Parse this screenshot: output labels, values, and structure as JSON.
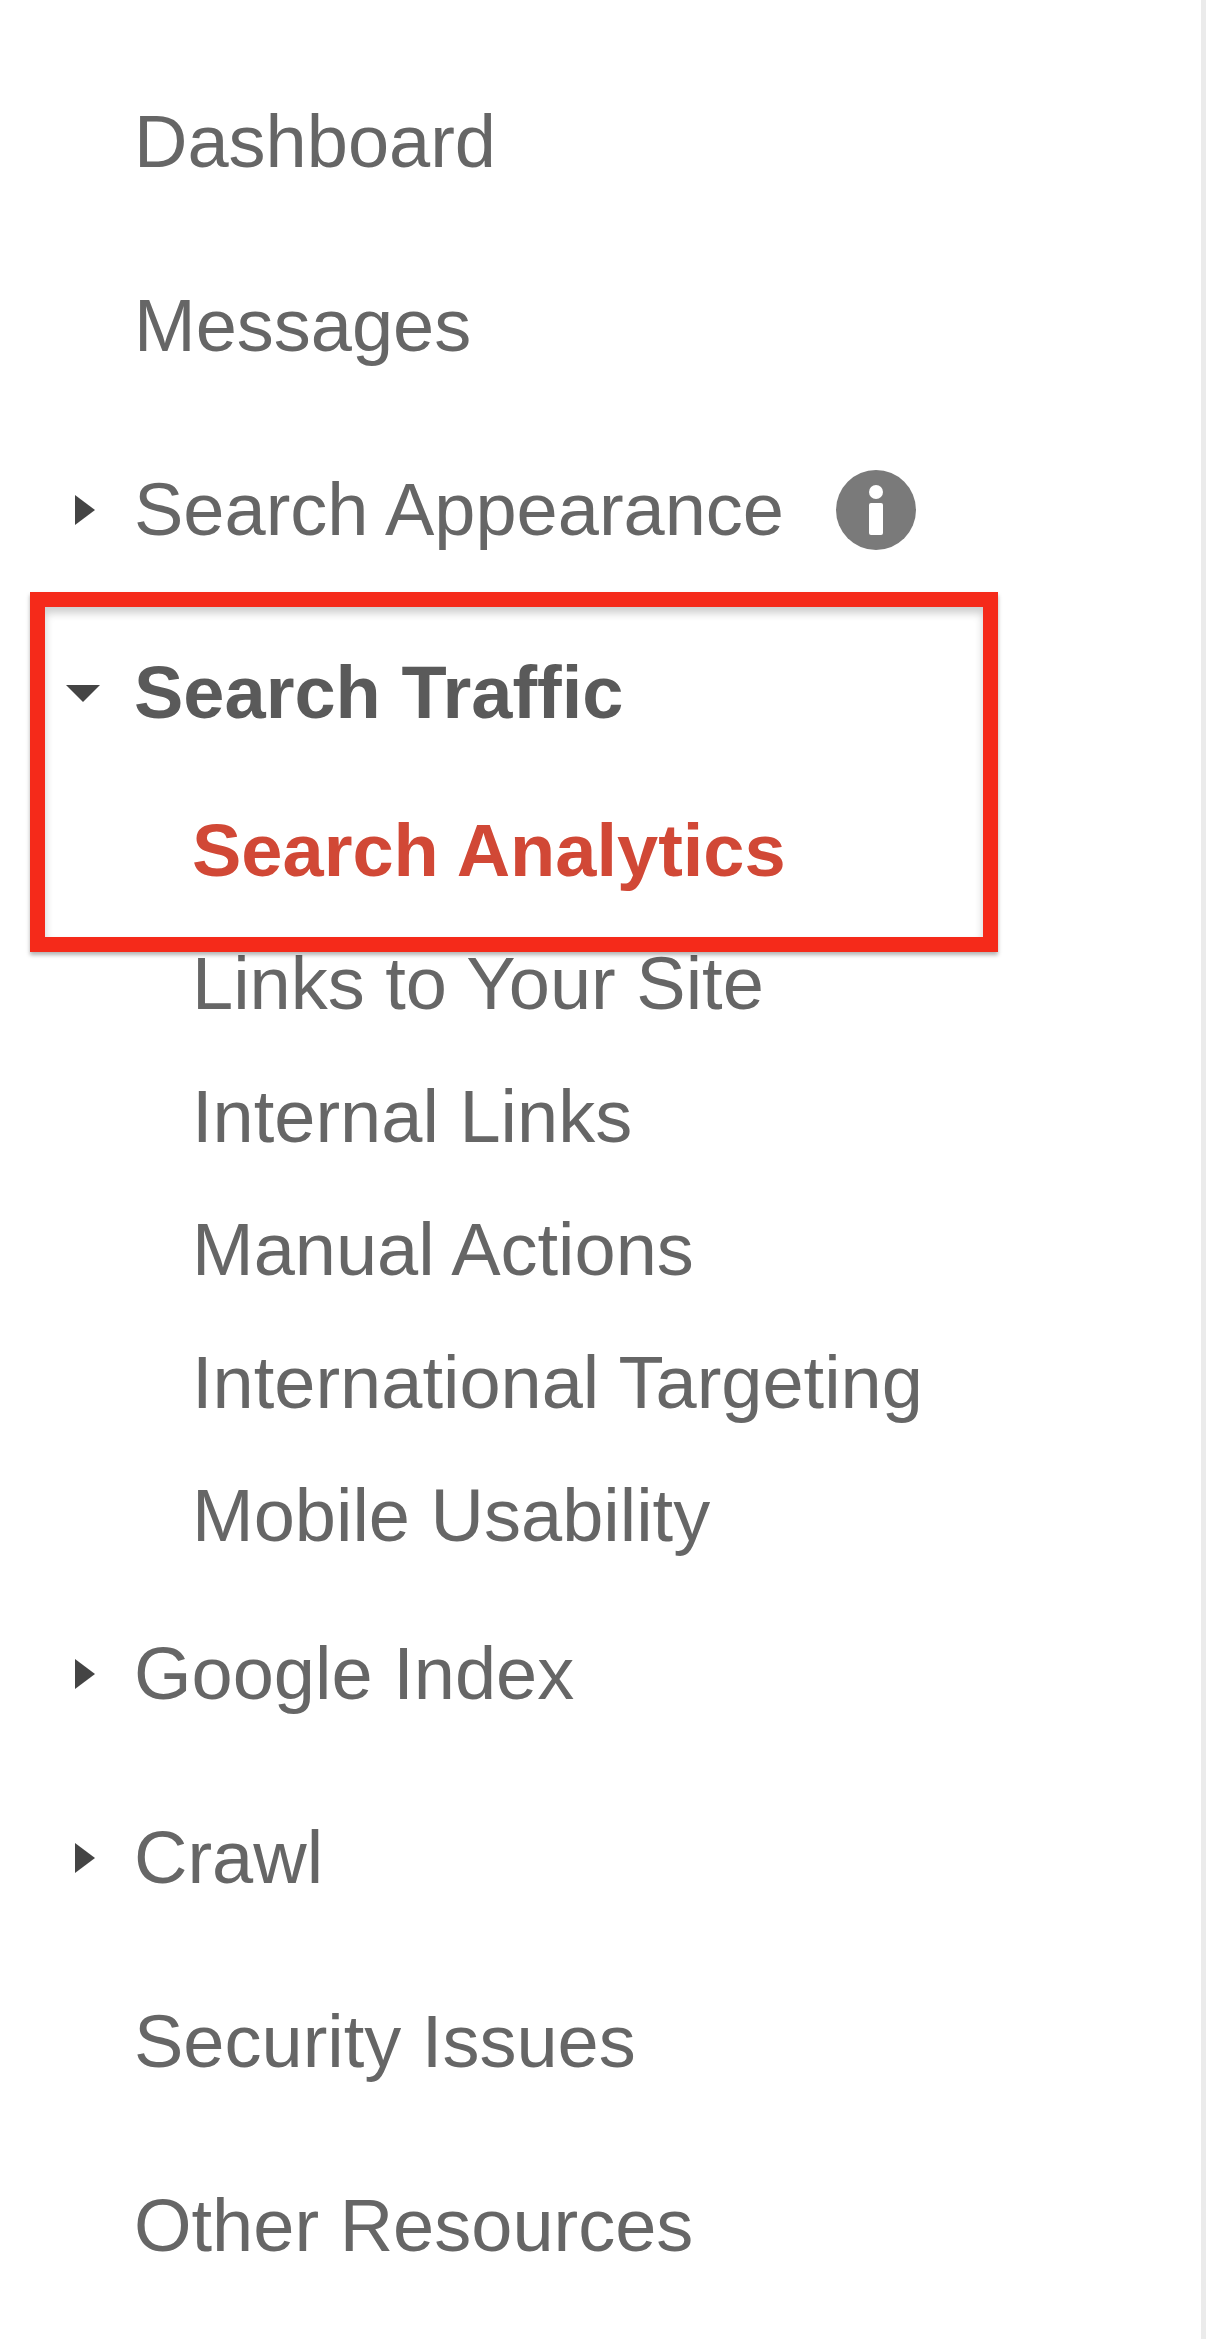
{
  "sidebar": {
    "items": [
      {
        "kind": "link",
        "label": "Dashboard",
        "selected": false
      },
      {
        "kind": "link",
        "label": "Messages",
        "selected": false
      },
      {
        "kind": "group",
        "label": "Search Appearance",
        "expanded": false,
        "selected": false,
        "info": true
      },
      {
        "kind": "group",
        "label": "Search Traffic",
        "expanded": true,
        "selected": false,
        "highlighted": true,
        "children": [
          {
            "label": "Search Analytics",
            "selected": true
          },
          {
            "label": "Links to Your Site",
            "selected": false
          },
          {
            "label": "Internal Links",
            "selected": false
          },
          {
            "label": "Manual Actions",
            "selected": false
          },
          {
            "label": "International Targeting",
            "selected": false
          },
          {
            "label": "Mobile Usability",
            "selected": false
          }
        ]
      },
      {
        "kind": "group",
        "label": "Google Index",
        "expanded": false,
        "selected": false
      },
      {
        "kind": "group",
        "label": "Crawl",
        "expanded": false,
        "selected": false
      },
      {
        "kind": "link",
        "label": "Security Issues",
        "selected": false
      },
      {
        "kind": "link",
        "label": "Other Resources",
        "selected": false
      }
    ]
  }
}
